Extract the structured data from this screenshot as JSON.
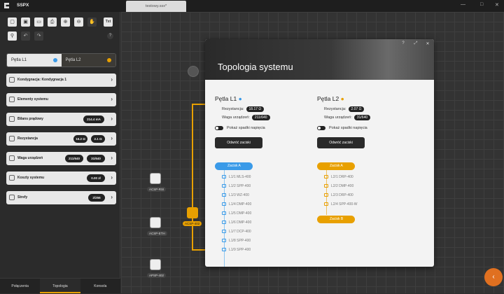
{
  "app": {
    "title": "SSPX"
  },
  "tab": {
    "name": "testowy.ssx*"
  },
  "toolbar": {
    "txt": "Txt",
    "help": "?"
  },
  "loops": {
    "l1": "Pętla L1",
    "l2": "Pętla L2",
    "l1_color": "#3a9ae8",
    "l2_color": "#e8a000"
  },
  "sidebar": {
    "config": "Kondygnacja: Kondygnacja 1",
    "elements": "Elementy systemu",
    "current": "Bilans prądowy",
    "current_val": "214.4 mA",
    "resist": "Rezystancja",
    "resist_v1": "16.2 Ω",
    "resist_v2": "2.1 Ω",
    "weight": "Waga urządzeń",
    "weight_v1": "211/640",
    "weight_v2": "31/640",
    "cost": "Koszty systemu",
    "cost_val": "0.00 zł",
    "zones": "Strefy",
    "zones_val": "2/256"
  },
  "bottom_tabs": {
    "connections": "Połączenia",
    "topology": "Topologia",
    "console": "Konsola"
  },
  "canvas": {
    "n1": "ACSP-RSI",
    "n2": "ACSP-ETH",
    "n3": "APSP-402",
    "n4": "ACSP-402"
  },
  "modal": {
    "title": "Topologia systemu",
    "l1": {
      "title": "Pętla L1",
      "resist_label": "Rezystancja:",
      "resist": "18.17 Ω",
      "weight_label": "Waga urządzeń:",
      "weight": "211/640",
      "drop": "Pokaż spadki napięcia",
      "reverse": "Odwróć zaciski",
      "clampA": "Zacisk A",
      "devices": [
        "L1/1 MLS-400",
        "L1/2 SPP-400",
        "L1/3 WZ-400",
        "L1/4 DMP-400",
        "L1/5 DMP-400",
        "L1/6 DMP-400",
        "L1/7 DCP-400",
        "L1/8 SPP-400",
        "L1/9 SPP-400"
      ]
    },
    "l2": {
      "title": "Pętla L2",
      "resist_label": "Rezystancja:",
      "resist": "2.07 Ω",
      "weight_label": "Waga urządzeń:",
      "weight": "31/640",
      "drop": "Pokaż spadki napięcia",
      "reverse": "Odwróć zaciski",
      "clampA": "Zacisk A",
      "clampB": "Zacisk B",
      "devices": [
        "L2/1 DRP-400",
        "L2/2 DMP-400",
        "L2/3 DRP-400",
        "L2/4 SPP-400-W"
      ]
    }
  }
}
